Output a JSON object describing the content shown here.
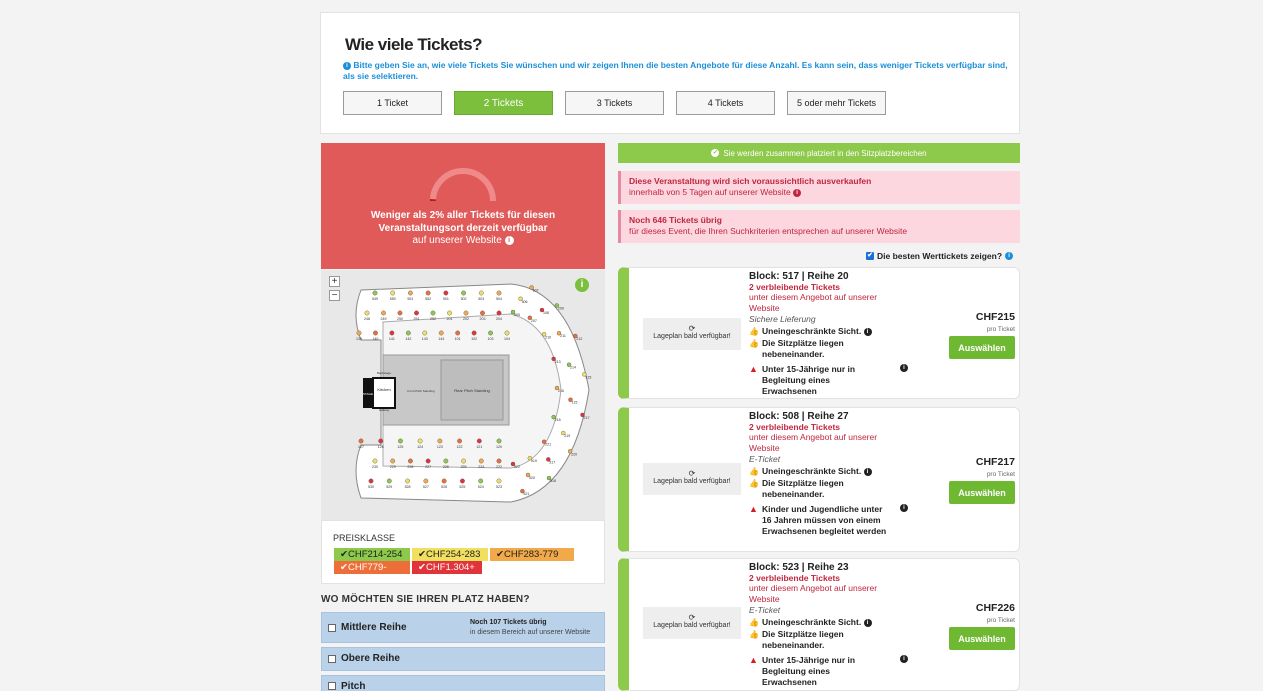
{
  "quantity": {
    "title": "Wie viele Tickets?",
    "info": "Bitte geben Sie an, wie viele Tickets Sie wünschen und wir zeigen Ihnen die besten Angebote für diese Anzahl. Es kann sein, dass weniger Tickets verfügbar sind, als sie selektieren.",
    "options": [
      "1 Ticket",
      "2 Tickets",
      "3 Tickets",
      "4 Tickets",
      "5 oder mehr Tickets"
    ],
    "selected": "2 Tickets"
  },
  "availability": {
    "line1": "Weniger als 2% aller Tickets für diesen",
    "line2": "Veranstaltungsort derzeit verfügbar",
    "line3": "auf unserer Website",
    "percent_available": 2
  },
  "map": {
    "zoom_in": "+",
    "zoom_out": "−",
    "info": "i",
    "stage_label": "STAGE",
    "stands": {
      "upper_left": [
        "549",
        "550",
        "551",
        "552",
        "501",
        "502",
        "503",
        "504"
      ],
      "mid_top": [
        "248",
        "249",
        "250",
        "251",
        "252",
        "201",
        "202",
        "203",
        "204"
      ],
      "lower_top": [
        "139",
        "140",
        "141",
        "142",
        "143",
        "144",
        "101",
        "102",
        "103",
        "104"
      ],
      "lower_bottom": [
        "127",
        "126",
        "125",
        "124",
        "123",
        "122",
        "121",
        "120"
      ],
      "mid_bottom": [
        "230",
        "229",
        "228",
        "227",
        "226",
        "225",
        "224",
        "222"
      ],
      "upper_bottom": [
        "530",
        "529",
        "528",
        "527",
        "526",
        "525",
        "524",
        "523"
      ],
      "right": [
        "505",
        "506",
        "507",
        "207",
        "108",
        "209",
        "210",
        "211",
        "212",
        "213",
        "214",
        "215",
        "216",
        "115",
        "217",
        "218",
        "219",
        "220",
        "221",
        "517",
        "518",
        "519",
        "520",
        "521",
        "522"
      ]
    },
    "zones": [
      "Kitchen",
      "Front Pitch Standing",
      "Rear Pitch Standing",
      "Backstage",
      "Hallway"
    ]
  },
  "price_legend": {
    "title": "PREISKLASSE",
    "items": [
      {
        "label": "CHF214-254",
        "color": "#8dc94a"
      },
      {
        "label": "CHF254-283",
        "color": "#f1e05f"
      },
      {
        "label": "CHF283-779",
        "color": "#f2a94a"
      },
      {
        "label": "CHF779-1.304",
        "color": "#ee6e3a"
      },
      {
        "label": "CHF1.304+",
        "color": "#e0343a"
      }
    ]
  },
  "where": {
    "title": "WO MÖCHTEN SIE IHREN PLATZ HABEN?",
    "zones": [
      {
        "label": "Mittlere Reihe",
        "r1": "Noch 107 Tickets übrig",
        "r2": "in diesem Bereich auf unserer Website"
      },
      {
        "label": "Obere Reihe",
        "r1": "",
        "r2": ""
      },
      {
        "label": "Pitch",
        "r1": "",
        "r2": ""
      }
    ]
  },
  "together_bar": "Sie werden zusammen platziert in den Sitzplatzbereichen",
  "alerts": [
    {
      "a1": "Diese Veranstaltung wird sich voraussichtlich ausverkaufen",
      "a2": "innerhalb von 5 Tagen auf unserer Website"
    },
    {
      "a1": "Noch 646 Tickets übrig",
      "a2": "für dieses Event, die Ihren Suchkriterien entsprechen auf unserer Website"
    }
  ],
  "best_value_label": "Die besten Werttickets zeigen?",
  "tickets": [
    {
      "block": "Block: 517 | Reihe 20",
      "remaining": "2 verbleibende Tickets",
      "remaining2": "unter diesem Angebot auf unserer Website",
      "delivery": "Sichere Lieferung",
      "plan": "Lageplan bald verfügbar!",
      "f1": "Uneingeschränkte Sicht.",
      "f2": "Die Sitzplätze liegen nebeneinander.",
      "warn": "Unter 15-Jährige nur in Begleitung eines Erwachsenen",
      "price": "CHF215",
      "per": "pro Ticket",
      "btn": "Auswählen"
    },
    {
      "block": "Block: 508 | Reihe 27",
      "remaining": "2 verbleibende Tickets",
      "remaining2": "unter diesem Angebot auf unserer Website",
      "delivery": "E-Ticket",
      "plan": "Lageplan bald verfügbar!",
      "f1": "Uneingeschränkte Sicht.",
      "f2": "Die Sitzplätze liegen nebeneinander.",
      "warn": "Kinder und Jugendliche unter 16 Jahren müssen von einem Erwachsenen begleitet werden",
      "price": "CHF217",
      "per": "pro Ticket",
      "btn": "Auswählen"
    },
    {
      "block": "Block: 523 | Reihe 23",
      "remaining": "2 verbleibende Tickets",
      "remaining2": "unter diesem Angebot auf unserer Website",
      "delivery": "E-Ticket",
      "plan": "Lageplan bald verfügbar!",
      "f1": "Uneingeschränkte Sicht.",
      "f2": "Die Sitzplätze liegen nebeneinander.",
      "warn": "Unter 15-Jährige nur in Begleitung eines Erwachsenen",
      "price": "CHF226",
      "per": "pro Ticket",
      "btn": "Auswählen"
    }
  ]
}
